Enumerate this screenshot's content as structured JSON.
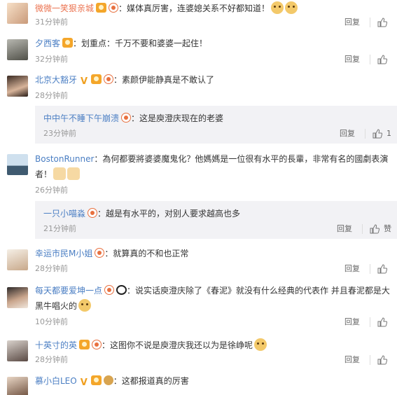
{
  "colors": {
    "username": "#eb7350",
    "username_blue": "#4a7ec3",
    "time": "#999999",
    "sub_bg": "#f2f2f5"
  },
  "comments": [
    {
      "user": "微微一笑狠亲城",
      "text": "：媒体真厉害，连婆媳关系不好都知道！",
      "time": "31分钟前",
      "reply": "回复",
      "like": ""
    },
    {
      "user": "夕西客",
      "text": "：划重点：千万不要和婆婆一起住！",
      "time": "32分钟前",
      "reply": "回复",
      "like": ""
    },
    {
      "user": "北京大豁牙",
      "text": "：素颜伊能静真是不敢认了",
      "time": "28分钟前",
      "reply": "回复",
      "like": ""
    },
    {
      "user": "中中午不睡下午崩溃",
      "text": "：这是庾澄庆现在的老婆",
      "time": "23分钟前",
      "reply": "回复",
      "like": "1"
    },
    {
      "user": "BostonRunner",
      "text": "：為何都要將婆婆魔鬼化？他媽媽是一位很有水平的長輩，非常有名的國劇表演者！",
      "time": "26分钟前",
      "reply": "回复",
      "like": ""
    },
    {
      "user": "一只小喵淼",
      "text": "：越是有水平的，对别人要求越高也多",
      "time": "21分钟前",
      "reply": "回复",
      "like": "赞"
    },
    {
      "user": "幸运市民M小姐",
      "text": "：就算真的不和也正常",
      "time": "28分钟前",
      "reply": "回复",
      "like": ""
    },
    {
      "user": "每天都要爱坤一点",
      "text": "：说实话庾澄庆除了《春泥》就没有什么经典的代表作  并且春泥都是大黑牛唱火的",
      "time": "10分钟前",
      "reply": "回复",
      "like": ""
    },
    {
      "user": "十英寸的英",
      "text": "：这图你不说是庾澄庆我还以为是徐峥呢",
      "time": "28分钟前",
      "reply": "回复",
      "like": ""
    },
    {
      "user": "慕小白LEO",
      "text": "：这都报道真的厉害",
      "time": "",
      "reply": "",
      "like": ""
    }
  ]
}
